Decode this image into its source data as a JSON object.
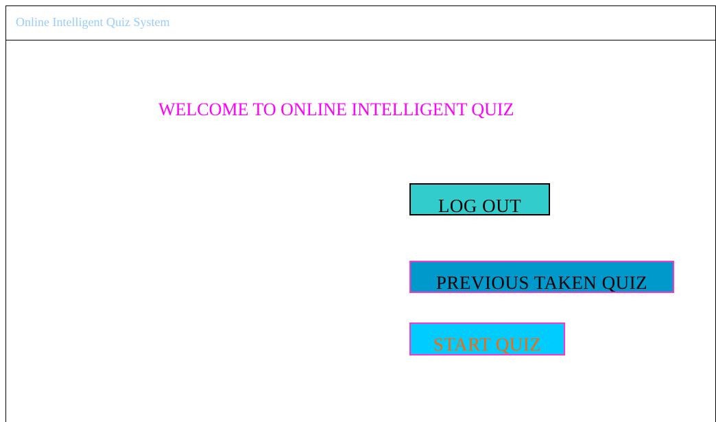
{
  "app": {
    "title": "Online Intelligent Quiz System"
  },
  "main": {
    "welcome_text": "WELCOME TO ONLINE INTELLIGENT QUIZ"
  },
  "buttons": {
    "logout": {
      "label": "LOG OUT",
      "background": "#33cccc",
      "border": "#000000",
      "text_color": "#000000"
    },
    "previous": {
      "label": "PREVIOUS TAKEN QUIZ",
      "background": "#0099cc",
      "border": "#ff33cc",
      "text_color": "#000000"
    },
    "start": {
      "label": "START QUIZ",
      "background": "#00ccff",
      "border": "#ff33cc",
      "text_color": "#ff6600"
    }
  },
  "colors": {
    "title_text": "#99ccff",
    "welcome_text": "#ff00ff"
  }
}
